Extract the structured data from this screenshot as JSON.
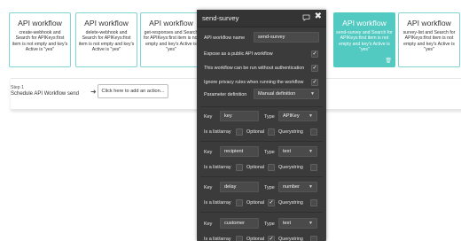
{
  "workflows": [
    {
      "title": "API workflow",
      "desc": "create-webhook and Search for APIKeys:first item is not empty and key's Active is \"yes\"",
      "active": false
    },
    {
      "title": "API workflow",
      "desc": "delete-webhook and Search for APIKeys:first item is not empty and key's Active is \"yes\"",
      "active": false
    },
    {
      "title": "API workflow",
      "desc": "get-responses and Search for APIKeys:first item is not empty and key's Active is \"yes\"",
      "active": false
    },
    {
      "title": "API workflow",
      "desc": "send-survey and Search for APIKeys:first item is not empty and key's Active is \"yes\"",
      "active": true
    },
    {
      "title": "API workflow",
      "desc": "survey-list and Search for APIKeys:first item is not empty and key's Active is \"yes\"",
      "active": false
    }
  ],
  "step": {
    "label": "Step 1",
    "name": "Schedule API Workflow send",
    "add_action": "Click here to add an action..."
  },
  "modal": {
    "title": "send-survey",
    "workflow_name_label": "API workflow name",
    "workflow_name_value": "send-survey",
    "expose_label": "Expose as a public API workflow",
    "expose_checked": true,
    "noauth_label": "This workflow can be run without authentication",
    "noauth_checked": true,
    "ignore_privacy_label": "Ignore privacy rules when running the workflow",
    "ignore_privacy_checked": true,
    "param_def_label": "Parameter definition",
    "param_def_value": "Manual definition",
    "key_label": "Key",
    "type_label": "Type",
    "is_list_label": "Is a list/array",
    "optional_label": "Optional",
    "querystring_label": "Querystring",
    "params": [
      {
        "key": "key",
        "type": "APIKey",
        "optional": false,
        "querystring": false
      },
      {
        "key": "recipient",
        "type": "text",
        "optional": false,
        "querystring": false
      },
      {
        "key": "delay",
        "type": "number",
        "optional": true,
        "querystring": false
      },
      {
        "key": "customer",
        "type": "text",
        "optional": true,
        "querystring": false
      }
    ]
  }
}
